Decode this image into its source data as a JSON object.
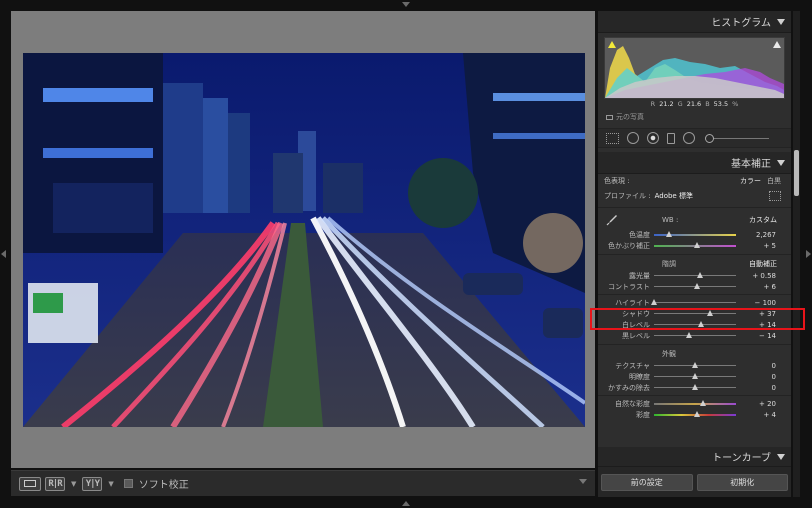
{
  "toolbar": {
    "view_double_label": "R|R",
    "view_yy_label": "Y|Y",
    "soft_proof_label": "ソフト校正"
  },
  "panel": {
    "histogram_title": "ヒストグラム",
    "histogram_readout": {
      "r_label": "R",
      "r_value": "21.2",
      "g_label": "G",
      "g_value": "21.6",
      "b_label": "B",
      "b_value": "53.5",
      "unit": "%"
    },
    "original_photo_label": "元の写真",
    "basic_title": "基本補正",
    "treatment_label": "色表現 :",
    "treatment_color": "カラー",
    "treatment_bw": "白黒",
    "profile_label": "プロファイル :",
    "profile_value": "Adobe 標準",
    "wb_label": "WB :",
    "wb_value": "カスタム",
    "temp": {
      "label": "色温度",
      "value": "2,267",
      "level": 0.18
    },
    "tint": {
      "label": "色かぶり補正",
      "value": "+ 5",
      "level": 0.52
    },
    "tone_label": "階調",
    "auto_label": "自動補正",
    "exposure": {
      "label": "露光量",
      "value": "+ 0.58",
      "level": 0.56
    },
    "contrast": {
      "label": "コントラスト",
      "value": "+ 6",
      "level": 0.52
    },
    "highlights": {
      "label": "ハイライト",
      "value": "− 100",
      "level": 0.0
    },
    "shadows": {
      "label": "シャドウ",
      "value": "+ 37",
      "level": 0.68
    },
    "whites": {
      "label": "白レベル",
      "value": "+ 14",
      "level": 0.57
    },
    "blacks": {
      "label": "黒レベル",
      "value": "− 14",
      "level": 0.43
    },
    "presence_label": "外観",
    "texture": {
      "label": "テクスチャ",
      "value": "0",
      "level": 0.5
    },
    "clarity": {
      "label": "明瞭度",
      "value": "0",
      "level": 0.5
    },
    "dehaze": {
      "label": "かすみの除去",
      "value": "0",
      "level": 0.5
    },
    "vibrance": {
      "label": "自然な彩度",
      "value": "+ 20",
      "level": 0.6
    },
    "saturation": {
      "label": "彩度",
      "value": "+ 4",
      "level": 0.52
    },
    "tone_curve_title": "トーンカーブ",
    "prev_button": "前の設定",
    "reset_button": "初期化"
  },
  "colors": {
    "accent_highlight": "#e8141a",
    "panel_bg": "#2e2e2e",
    "canvas_bg": "#7d7d7d"
  }
}
